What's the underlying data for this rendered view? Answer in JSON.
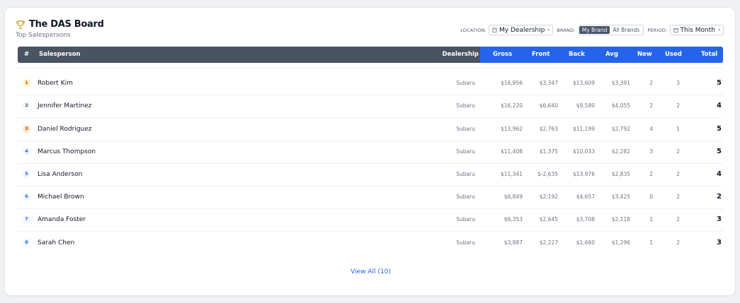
{
  "header": {
    "title": "The DAS Board",
    "subtitle": "Top Salespersons"
  },
  "filters": {
    "location_label": "LOCATION:",
    "location_value": "My Dealership",
    "brand_label": "BRAND:",
    "brand_options": [
      "My Brand",
      "All Brands"
    ],
    "brand_selected": "My Brand",
    "period_label": "PERIOD:",
    "period_value": "This Month"
  },
  "table": {
    "columns": {
      "rank": "#",
      "salesperson": "Salesperson",
      "dealership": "Dealership",
      "gross": "Gross",
      "front": "Front",
      "back": "Back",
      "avg": "Avg",
      "new": "New",
      "used": "Used",
      "total": "Total"
    },
    "rows": [
      {
        "rank": "1",
        "name": "Robert Kim",
        "dealership": "Subaru",
        "gross": "$16,956",
        "front": "$3,347",
        "back": "$13,609",
        "avg": "$3,391",
        "new": "2",
        "used": "3",
        "total": "5"
      },
      {
        "rank": "2",
        "name": "Jennifer Martinez",
        "dealership": "Subaru",
        "gross": "$16,220",
        "front": "$6,640",
        "back": "$9,580",
        "avg": "$4,055",
        "new": "2",
        "used": "2",
        "total": "4"
      },
      {
        "rank": "3",
        "name": "Daniel Rodriguez",
        "dealership": "Subaru",
        "gross": "$13,962",
        "front": "$2,763",
        "back": "$11,199",
        "avg": "$2,792",
        "new": "4",
        "used": "1",
        "total": "5"
      },
      {
        "rank": "4",
        "name": "Marcus Thompson",
        "dealership": "Subaru",
        "gross": "$11,408",
        "front": "$1,375",
        "back": "$10,033",
        "avg": "$2,282",
        "new": "3",
        "used": "2",
        "total": "5"
      },
      {
        "rank": "5",
        "name": "Lisa Anderson",
        "dealership": "Subaru",
        "gross": "$11,341",
        "front": "$-2,635",
        "back": "$13,976",
        "avg": "$2,835",
        "new": "2",
        "used": "2",
        "total": "4"
      },
      {
        "rank": "6",
        "name": "Michael Brown",
        "dealership": "Subaru",
        "gross": "$6,849",
        "front": "$2,192",
        "back": "$4,657",
        "avg": "$3,425",
        "new": "0",
        "used": "2",
        "total": "2"
      },
      {
        "rank": "7",
        "name": "Amanda Foster",
        "dealership": "Subaru",
        "gross": "$6,353",
        "front": "$2,645",
        "back": "$3,708",
        "avg": "$2,118",
        "new": "1",
        "used": "2",
        "total": "3"
      },
      {
        "rank": "8",
        "name": "Sarah Chen",
        "dealership": "Subaru",
        "gross": "$3,887",
        "front": "$2,227",
        "back": "$1,660",
        "avg": "$1,296",
        "new": "1",
        "used": "2",
        "total": "3"
      }
    ]
  },
  "footer": {
    "view_all": "View All (10)"
  },
  "colors": {
    "header_dark": "#4a5362",
    "header_accent": "#2563eb",
    "link": "#2563eb"
  }
}
